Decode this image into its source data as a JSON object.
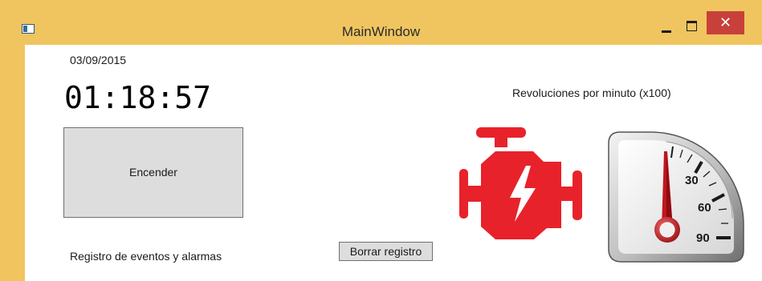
{
  "window": {
    "title": "MainWindow",
    "close_glyph": "✕"
  },
  "main": {
    "date": "03/09/2015",
    "clock": "01:18:57",
    "power_button": "Encender",
    "rpm_label": "Revoluciones por minuto (x100)",
    "log_label": "Registro de eventos y alarmas",
    "clear_log_button": "Borrar registro"
  },
  "gauge": {
    "ticks": [
      "30",
      "60",
      "90"
    ],
    "needle_color": "#c0151c"
  },
  "engine": {
    "icon": "engine-warning-icon",
    "color": "#e8222a"
  }
}
